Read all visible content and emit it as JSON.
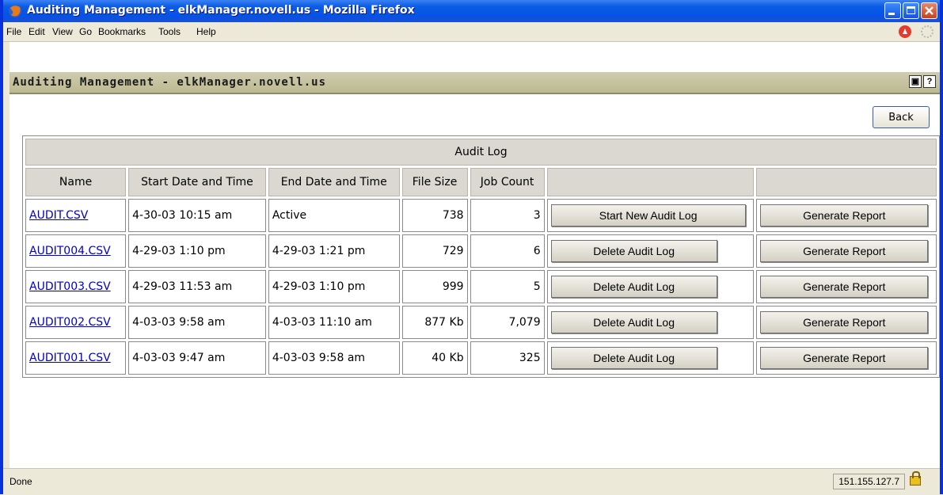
{
  "window": {
    "title": "Auditing Management - elkManager.novell.us - Mozilla Firefox"
  },
  "menu": [
    "File",
    "Edit",
    "View",
    "Go",
    "Bookmarks",
    "Tools",
    "Help"
  ],
  "page": {
    "header": "Auditing Management - elkManager.novell.us",
    "back_label": "Back"
  },
  "table": {
    "caption": "Audit Log",
    "headers": [
      "Name",
      "Start Date and Time",
      "End Date and Time",
      "File Size",
      "Job Count"
    ],
    "rows": [
      {
        "name": "AUDIT.CSV",
        "start": "4-30-03 10:15 am",
        "end": "Active",
        "size": "738",
        "jobs": "3",
        "action": "Start New Audit Log",
        "report": "Generate Report"
      },
      {
        "name": "AUDIT004.CSV",
        "start": "4-29-03 1:10 pm",
        "end": "4-29-03 1:21 pm",
        "size": "729",
        "jobs": "6",
        "action": "Delete Audit Log",
        "report": "Generate Report"
      },
      {
        "name": "AUDIT003.CSV",
        "start": "4-29-03 11:53 am",
        "end": "4-29-03 1:10 pm",
        "size": "999",
        "jobs": "5",
        "action": "Delete Audit Log",
        "report": "Generate Report"
      },
      {
        "name": "AUDIT002.CSV",
        "start": "4-03-03 9:58 am",
        "end": "4-03-03 11:10 am",
        "size": "877 Kb",
        "jobs": "7,079",
        "action": "Delete Audit Log",
        "report": "Generate Report"
      },
      {
        "name": "AUDIT001.CSV",
        "start": "4-03-03 9:47 am",
        "end": "4-03-03 9:58 am",
        "size": "40 Kb",
        "jobs": "325",
        "action": "Delete Audit Log",
        "report": "Generate Report"
      }
    ]
  },
  "status": {
    "text": "Done",
    "ip": "151.155.127.7"
  }
}
